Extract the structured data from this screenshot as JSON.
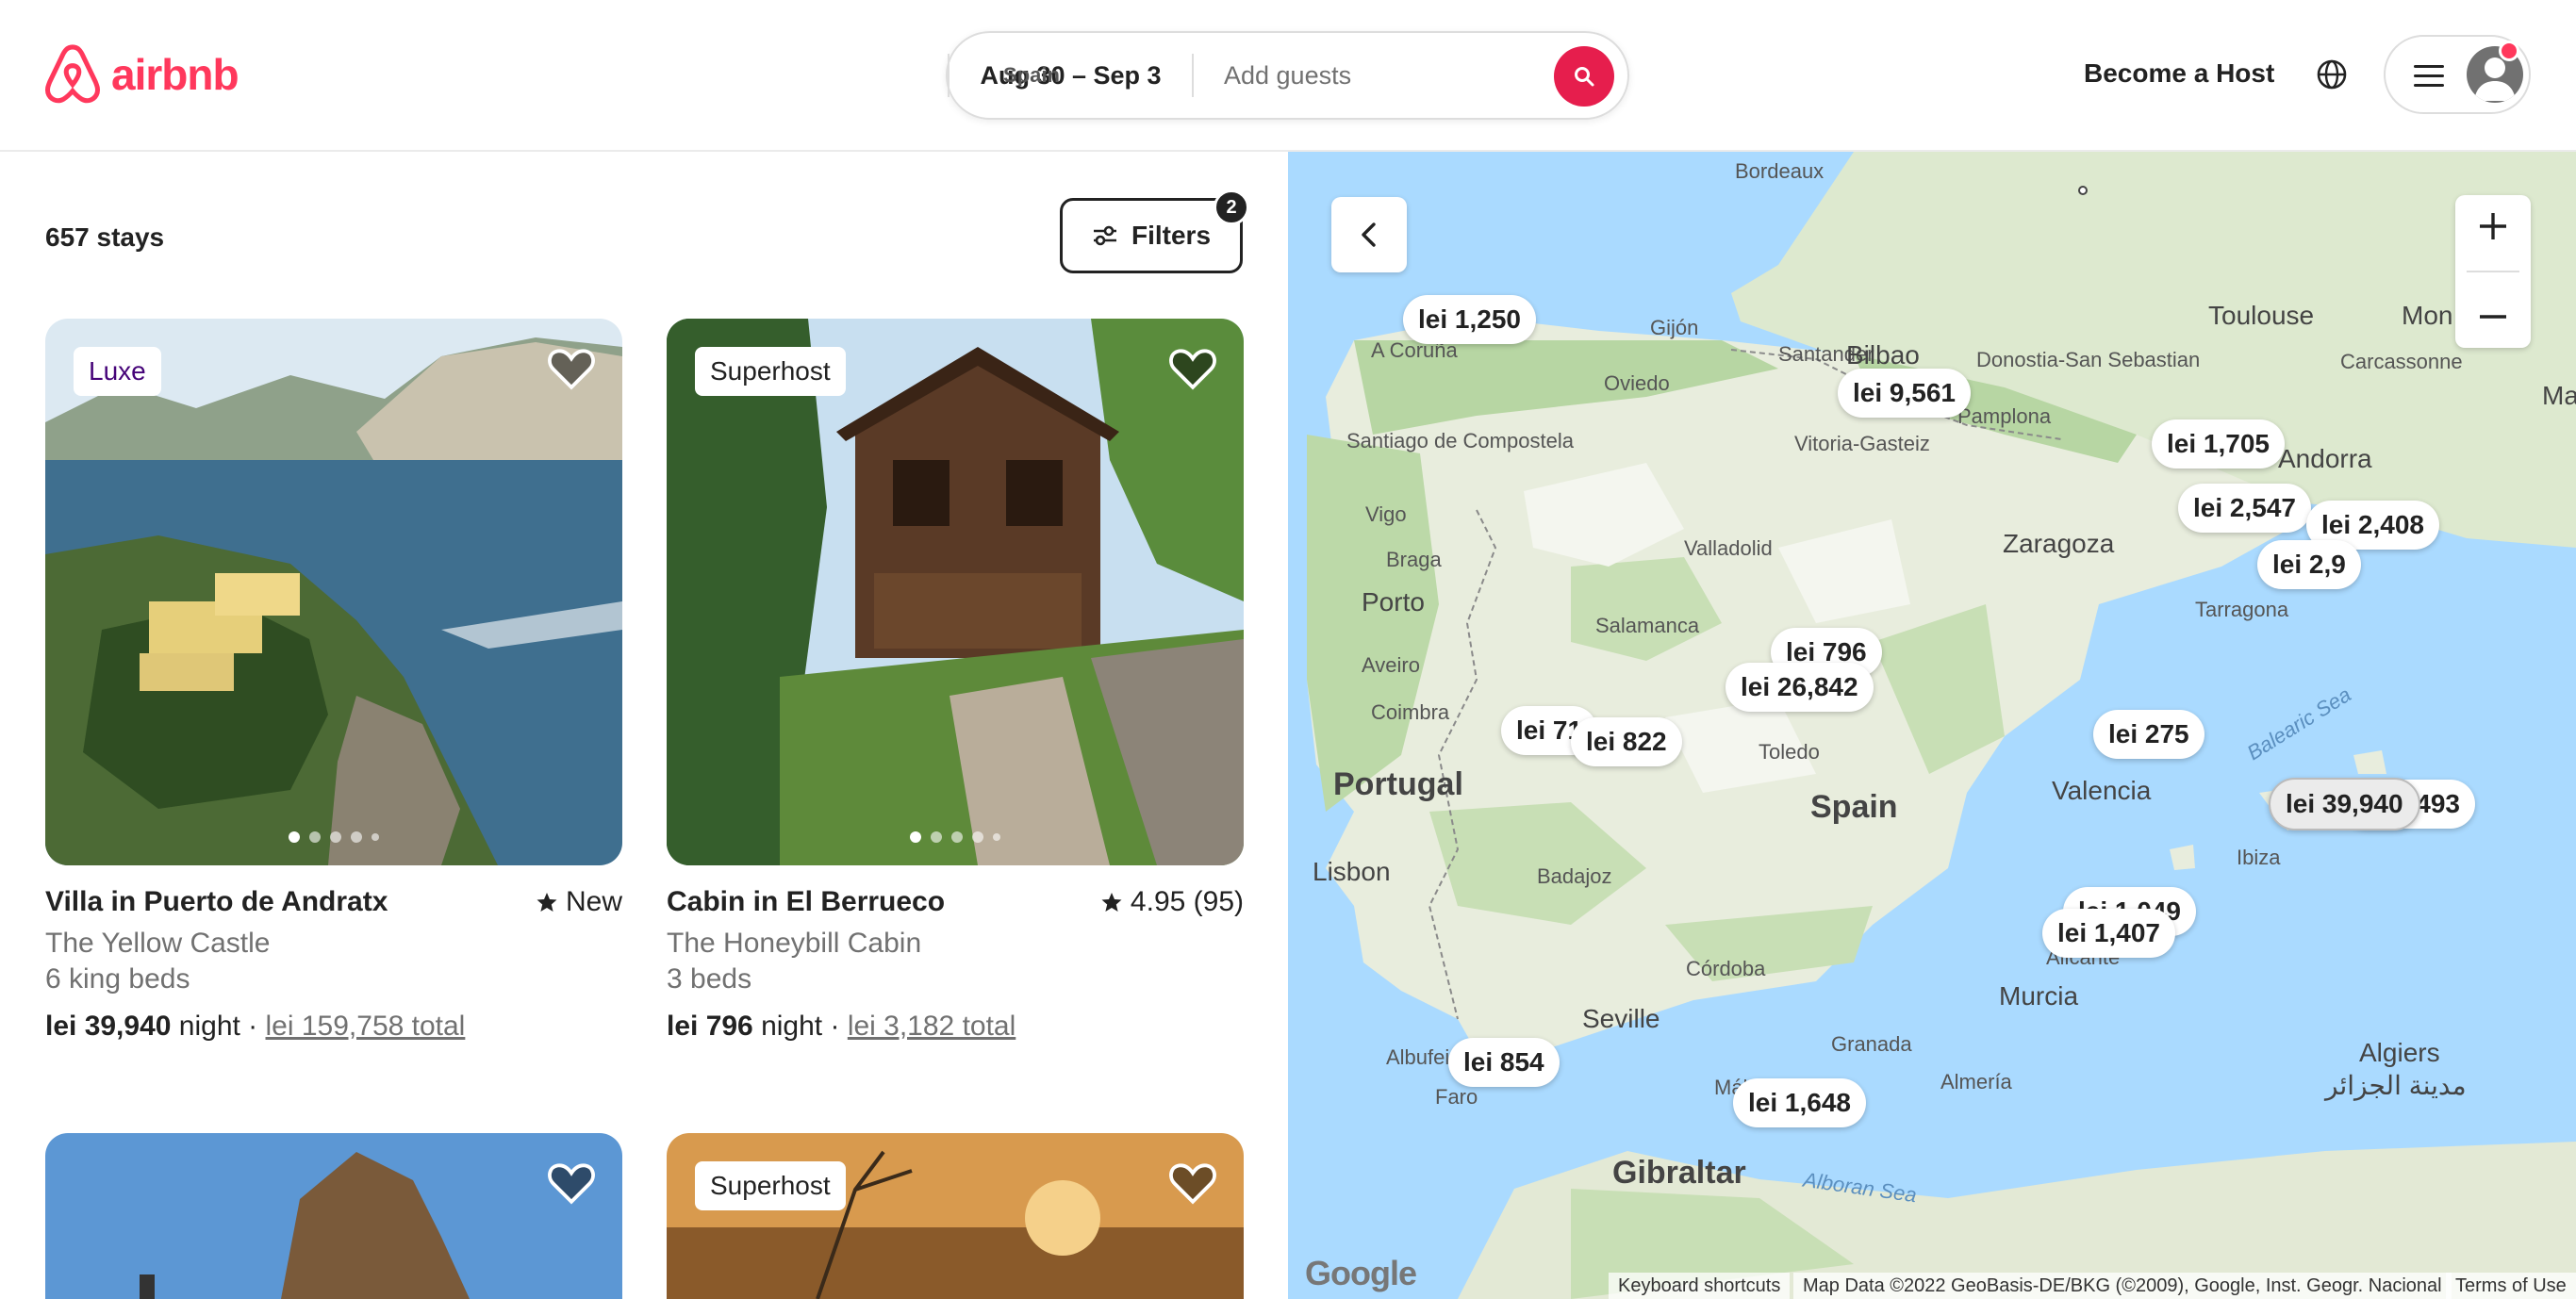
{
  "header": {
    "brand": "airbnb",
    "search": {
      "place": "Spain",
      "dates": "Aug 30 – Sep 3",
      "guests_placeholder": "Add guests"
    },
    "become_host": "Become a Host"
  },
  "listing": {
    "count": "657 stays",
    "filters_label": "Filters",
    "filters_count": "2",
    "cards": [
      {
        "badge": "Luxe",
        "title": "Villa in Puerto de Andratx",
        "rating": "New",
        "subtitle": "The Yellow Castle",
        "beds": "6 king beds",
        "price": "lei 39,940",
        "unit": " night · ",
        "total": "lei 159,758 total"
      },
      {
        "badge": "Superhost",
        "title": "Cabin in El Berrueco",
        "rating": "4.95 (95)",
        "subtitle": "The Honeybill Cabin",
        "beds": "3 beds",
        "price": "lei 796",
        "unit": " night · ",
        "total": "lei 3,182 total"
      },
      {
        "badge": "",
        "title": "",
        "rating": "",
        "subtitle": "",
        "beds": "",
        "price": "",
        "unit": "",
        "total": ""
      },
      {
        "badge": "Superhost",
        "title": "",
        "rating": "",
        "subtitle": "",
        "beds": "",
        "price": "",
        "unit": "",
        "total": ""
      }
    ]
  },
  "map": {
    "pins": [
      "lei 1,250",
      "lei 9,561",
      "lei 1,705",
      "lei 2,547",
      "lei 2,408",
      "lei 2,9",
      "lei 796",
      "lei 26,842",
      "lei 71",
      "lei 822",
      "lei 275",
      "lei 39,940",
      "lei 3,493",
      "lei 1,049",
      "lei 1,407",
      "lei 854",
      "lei 1,648"
    ],
    "places": {
      "countries": [
        "Portugal",
        "Spain",
        "Gibraltar",
        "Algiers"
      ],
      "cities": [
        "Bordeaux",
        "Toulouse",
        "Mon",
        "Carcassonne",
        "Ma",
        "Gijón",
        "Santander",
        "Bilbao",
        "Donostia-San Sebastian",
        "A Coruña",
        "Oviedo",
        "Vitoria-Gasteiz",
        "Pamplona",
        "Santiago de Compostela",
        "Vigo",
        "Braga",
        "Valladolid",
        "Zaragoza",
        "Porto",
        "Salamanca",
        "Tarragona",
        "Aveiro",
        "Coimbra",
        "Toledo",
        "Valencia",
        "Ibiza",
        "Lisbon",
        "Badajoz",
        "Córdoba",
        "Murcia",
        "Alicante",
        "Seville",
        "Granada",
        "Almería",
        "Albufeira",
        "Faro",
        "Málaga",
        "Andorra",
        "مدينة الجزائر"
      ],
      "seas": [
        "Balearic Sea",
        "Alboran Sea"
      ]
    },
    "attribution": {
      "keyboard": "Keyboard shortcuts",
      "data": "Map Data ©2022 GeoBasis-DE/BKG (©2009), Google, Inst. Geogr. Nacional",
      "terms": "Terms of Use",
      "google": "Google"
    }
  }
}
